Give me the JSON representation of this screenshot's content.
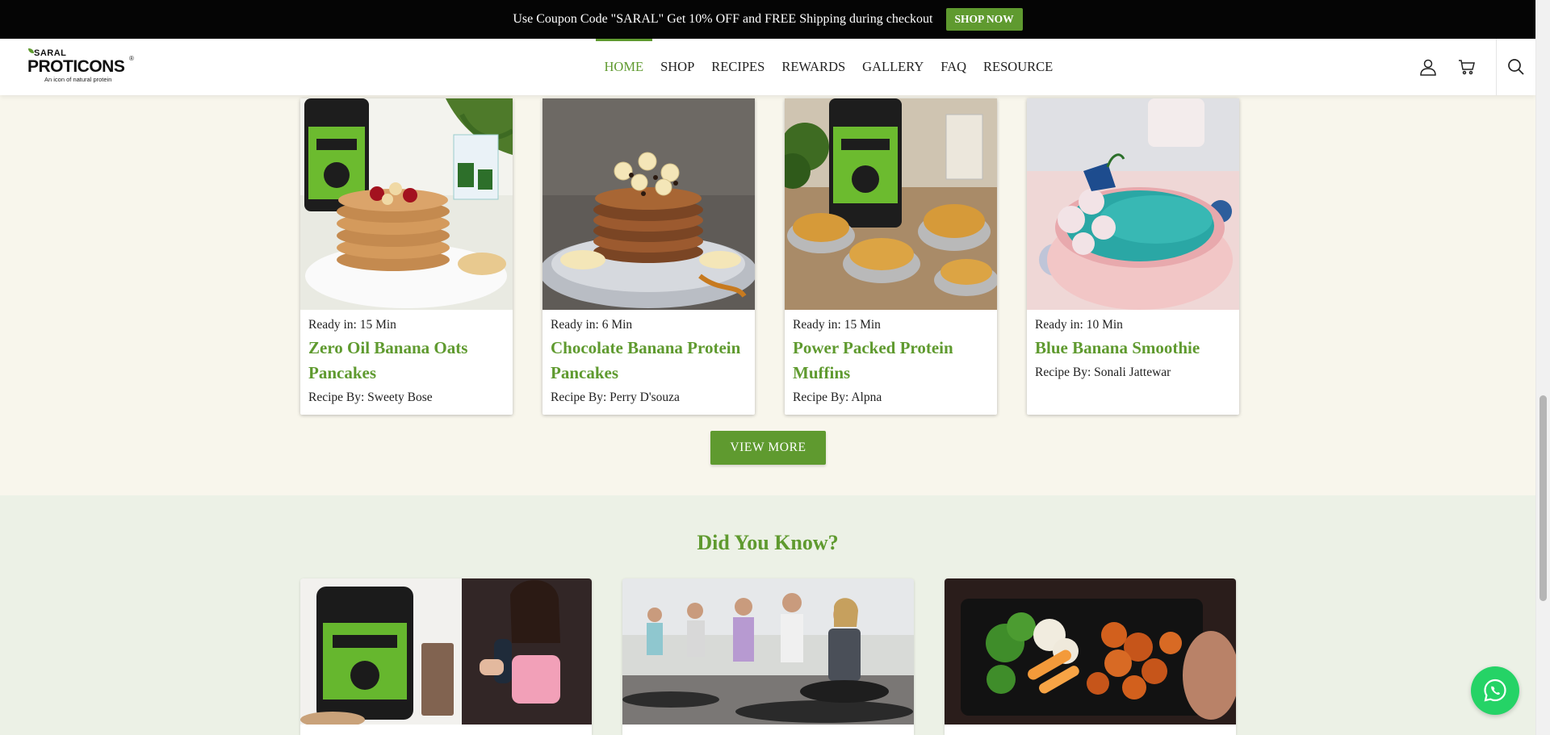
{
  "announcement": {
    "text": "Use Coupon Code \"SARAL\" Get 10% OFF and FREE Shipping during checkout",
    "button": "SHOP NOW"
  },
  "logo": {
    "small": "SARAL",
    "main": "PROTICONS",
    "reg": "®",
    "tagline": "An icon of natural protein"
  },
  "nav": {
    "items": [
      {
        "label": "HOME",
        "active": true
      },
      {
        "label": "SHOP"
      },
      {
        "label": "RECIPES"
      },
      {
        "label": "REWARDS"
      },
      {
        "label": "GALLERY"
      },
      {
        "label": "FAQ"
      },
      {
        "label": "RESOURCE"
      }
    ]
  },
  "header_icons": [
    "user-icon",
    "cart-icon",
    "search-icon"
  ],
  "recipes": [
    {
      "ready": "Ready in: 15 Min",
      "title": "Zero Oil Banana Oats Pancakes",
      "by": "Recipe By: Sweety Bose"
    },
    {
      "ready": "Ready in: 6 Min",
      "title": "Chocolate Banana Protein Pancakes",
      "by": "Recipe By: Perry D'souza"
    },
    {
      "ready": "Ready in: 15 Min",
      "title": "Power Packed Protein Muffins",
      "by": "Recipe By: Alpna"
    },
    {
      "ready": "Ready in: 10 Min",
      "title": "Blue Banana Smoothie",
      "by": "Recipe By: Sonali Jattewar"
    }
  ],
  "view_more": "VIEW MORE",
  "did_you_know": {
    "title": "Did You Know?"
  },
  "colors": {
    "brand_green": "#5f9a2f",
    "announcement_bg": "#050505",
    "section_bg": "#f8f6ec",
    "dyk_bg": "#ecf1e6",
    "whatsapp": "#25d366"
  },
  "whatsapp_icon": "whatsapp-icon"
}
